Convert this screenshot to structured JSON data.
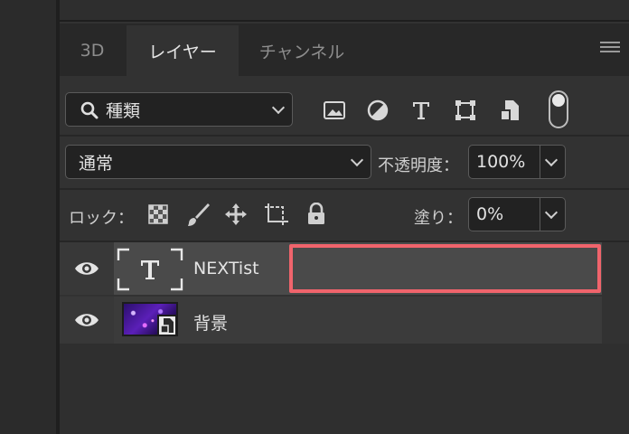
{
  "tabs": [
    {
      "label": "3D",
      "active": false
    },
    {
      "label": "レイヤー",
      "active": true
    },
    {
      "label": "チャンネル",
      "active": false
    }
  ],
  "filter": {
    "kind_label": "種類",
    "icons": [
      "image-filter-icon",
      "adjustment-filter-icon",
      "type-filter-icon",
      "shape-filter-icon",
      "smart-object-filter-icon"
    ],
    "toggle_on": true
  },
  "blend": {
    "mode": "通常",
    "opacity_label": "不透明度：",
    "opacity_value": "100%"
  },
  "lock": {
    "label": "ロック：",
    "icons": [
      "lock-transparent-pixels-icon",
      "lock-image-pixels-icon",
      "lock-position-icon",
      "lock-artboard-icon",
      "lock-all-icon"
    ],
    "fill_label": "塗り：",
    "fill_value": "0%"
  },
  "layers": [
    {
      "name": "NEXTist",
      "type": "text",
      "visible": true,
      "selected": true
    },
    {
      "name": "背景",
      "type": "smart-object",
      "visible": true,
      "selected": false
    }
  ],
  "colors": {
    "highlight": "#f0646c",
    "panel_bg": "#323232",
    "selected_row": "#4a4a4a"
  }
}
